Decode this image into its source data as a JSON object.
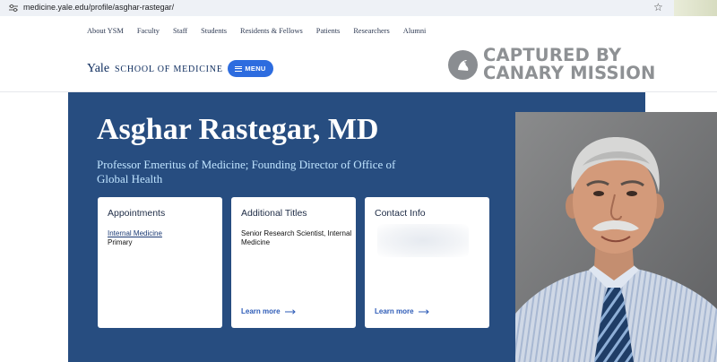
{
  "browser": {
    "url": "medicine.yale.edu/profile/asghar-rastegar/"
  },
  "nav": {
    "items": [
      "About YSM",
      "Faculty",
      "Staff",
      "Students",
      "Residents & Fellows",
      "Patients",
      "Researchers",
      "Alumni"
    ]
  },
  "header": {
    "logo_main": "Yale",
    "logo_sub": "SCHOOL OF MEDICINE",
    "menu_label": "MENU"
  },
  "watermark": {
    "line1": "CAPTURED BY",
    "line2": "CANARY MISSION"
  },
  "profile": {
    "name": "Asghar Rastegar, MD",
    "subtitle": "Professor Emeritus of Medicine; Founding Director of Office of Global Health"
  },
  "cards": {
    "appointments": {
      "title": "Appointments",
      "link": "Internal Medicine",
      "detail": "Primary"
    },
    "additional": {
      "title": "Additional Titles",
      "detail": "Senior Research Scientist, Internal Medicine",
      "more": "Learn more"
    },
    "contact": {
      "title": "Contact Info",
      "more": "Learn more"
    }
  },
  "colors": {
    "hero_bg": "#274d80",
    "accent_blue": "#2d6cdf",
    "subtitle": "#bfe4ff"
  }
}
